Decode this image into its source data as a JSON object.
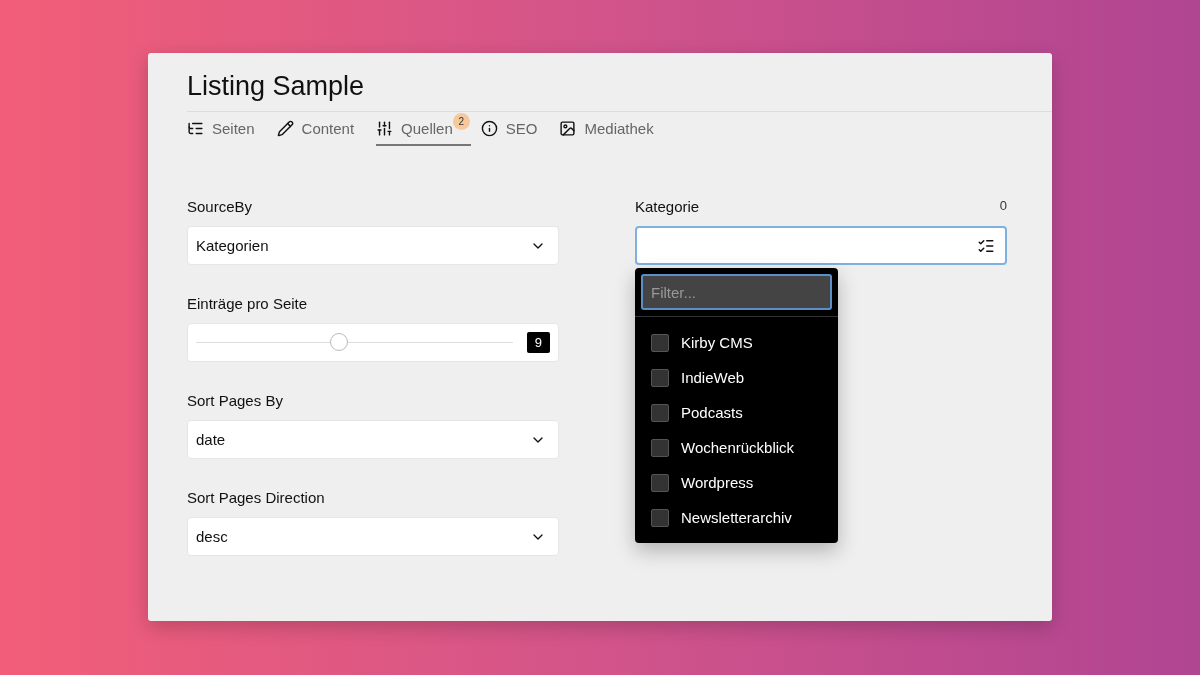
{
  "title": "Listing Sample",
  "tabs": [
    {
      "label": "Seiten",
      "selected": false
    },
    {
      "label": "Content",
      "selected": false
    },
    {
      "label": "Quellen",
      "selected": true,
      "badge": "2"
    },
    {
      "label": "SEO",
      "selected": false
    },
    {
      "label": "Mediathek",
      "selected": false
    }
  ],
  "left_fields": [
    {
      "kind": "select",
      "label": "SourceBy",
      "value": "Kategorien"
    },
    {
      "kind": "range",
      "label": "Einträge pro Seite",
      "level": 0.45,
      "reading": "9"
    },
    {
      "kind": "select",
      "label": "Sort Pages By",
      "value": "date"
    },
    {
      "kind": "select",
      "label": "Sort Pages Direction",
      "value": "desc"
    }
  ],
  "category": {
    "label": "Kategorie",
    "counter": "0",
    "focused": true,
    "dropdown": {
      "filter_placeholder": "Filter...",
      "options": [
        {
          "label": "Kirby CMS",
          "checked": false
        },
        {
          "label": "IndieWeb",
          "checked": false
        },
        {
          "label": "Podcasts",
          "checked": false
        },
        {
          "label": "Wochenrückblick",
          "checked": false
        },
        {
          "label": "Wordpress",
          "checked": false
        },
        {
          "label": "Newsletterarchiv",
          "checked": false
        }
      ]
    }
  }
}
